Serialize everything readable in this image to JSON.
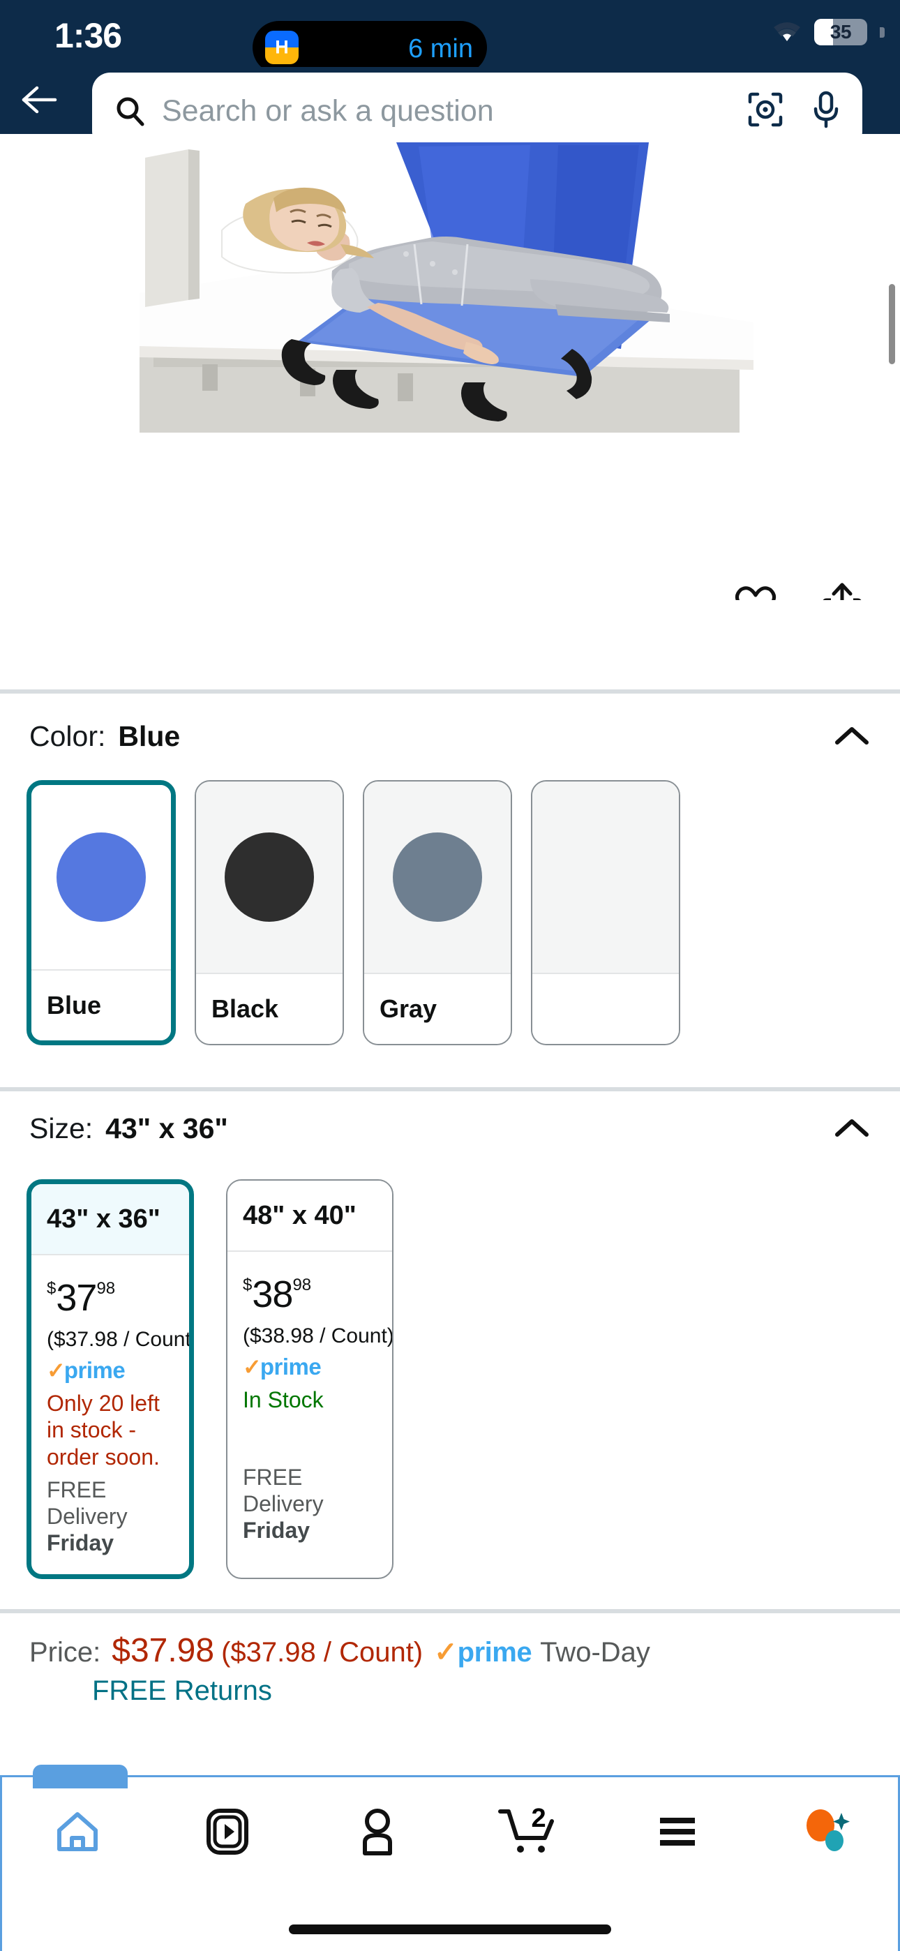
{
  "status_bar": {
    "time": "1:36",
    "dynamic_island": {
      "app_glyph": "H",
      "label": "6 min"
    },
    "wifi_icon": "wifi-icon",
    "battery_level": "35",
    "battery_percent": 35
  },
  "header": {
    "back_icon": "back-arrow-icon",
    "search": {
      "icon": "search-icon",
      "placeholder": "Search or ask a question",
      "value": "",
      "camera_icon": "camera-lens-icon",
      "mic_icon": "microphone-icon"
    }
  },
  "gallery": {
    "image_alt": "Patient positioning transfer sling on hospital bed",
    "dot_count": 5,
    "active_dot": 1,
    "wishlist_icon": "heart-icon",
    "share_icon": "share-icon"
  },
  "color_section": {
    "label": "Color:",
    "selected": "Blue",
    "collapse_icon": "chevron-up-icon",
    "options": [
      {
        "name": "Blue",
        "hex": "#5578e0",
        "selected": true
      },
      {
        "name": "Black",
        "hex": "#2e2e2e",
        "selected": false
      },
      {
        "name": "Gray",
        "hex": "#6e7f90",
        "selected": false
      },
      {
        "name": "",
        "hex": "#f4f5f5",
        "selected": false
      }
    ]
  },
  "size_section": {
    "label": "Size:",
    "selected": "43\" x 36\"",
    "collapse_icon": "chevron-up-icon",
    "options": [
      {
        "name": "43\" x 36\"",
        "currency": "$",
        "whole": "37",
        "fraction": "98",
        "unit_price": "($37.98 / Count)",
        "prime": true,
        "stock_text": "Only 20 left in stock - order soon.",
        "stock_state": "low",
        "delivery_label": "FREE Delivery",
        "delivery_day": "Friday",
        "selected": true
      },
      {
        "name": "48\" x 40\"",
        "currency": "$",
        "whole": "38",
        "fraction": "98",
        "unit_price": "($38.98 / Count)",
        "prime": true,
        "stock_text": "In Stock",
        "stock_state": "ok",
        "delivery_label": "FREE Delivery",
        "delivery_day": "Friday",
        "selected": false
      }
    ]
  },
  "price_block": {
    "label": "Price:",
    "amount": "$37.98",
    "unit_price": "($37.98 / Count)",
    "prime_check": "✓",
    "prime_word": "prime",
    "shipping_speed": "Two-Day",
    "returns_link": "FREE Returns"
  },
  "bottom_nav": {
    "items": [
      {
        "name": "home",
        "icon": "home-icon",
        "active": true,
        "badge": ""
      },
      {
        "name": "reels",
        "icon": "video-play-icon",
        "active": false,
        "badge": ""
      },
      {
        "name": "account",
        "icon": "person-icon",
        "active": false,
        "badge": ""
      },
      {
        "name": "cart",
        "icon": "cart-icon",
        "active": false,
        "badge": "2"
      },
      {
        "name": "menu",
        "icon": "hamburger-menu-icon",
        "active": false,
        "badge": ""
      },
      {
        "name": "rufus",
        "icon": "rufus-assistant-icon",
        "active": false,
        "badge": ""
      }
    ]
  },
  "colors": {
    "header_bg": "#0d2b49",
    "accent_teal": "#007782",
    "price_red": "#b12704",
    "in_stock_green": "#007600",
    "prime_blue": "#3aa8f0",
    "prime_orange": "#f79c34",
    "link_teal": "#007185",
    "nav_active_blue": "#5a9fe0"
  }
}
